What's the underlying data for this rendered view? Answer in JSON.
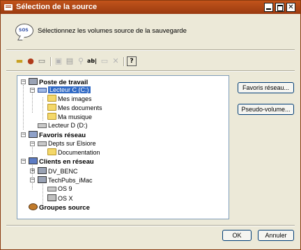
{
  "window": {
    "title": "Sélection de la source",
    "header_text": "Sélectionnez les volumes source de la sauvegarde",
    "header_icon_text": "SOS"
  },
  "toolbar": {
    "icons": [
      "open-folder-icon",
      "user-settings-icon",
      "drive-icon",
      "network-disabled-icon",
      "computer-disabled-icon",
      "filter-disabled-icon",
      "rename-icon",
      "comment-disabled-icon",
      "delete-disabled-icon",
      "help-icon"
    ]
  },
  "tree": {
    "poste_de_travail": "Poste de travail",
    "lecteur_c": "Lecteur C (C:)",
    "mes_images": "Mes images",
    "mes_documents": "Mes documents",
    "ma_musique": "Ma musique",
    "lecteur_d": "Lecteur D (D:)",
    "favoris_reseau": "Favoris réseau",
    "depts": "Depts sur Elsiore",
    "documentation": "Documentation",
    "clients_en_reseau": "Clients en réseau",
    "dv_benc": "DV_BENC",
    "techpubs_imac": "TechPubs_iMac",
    "os9": "OS 9",
    "osx": "OS X",
    "groupes_source": "Groupes source"
  },
  "buttons": {
    "favoris_reseau": "Favoris réseau...",
    "pseudo_volume": "Pseudo-volume...",
    "ok": "OK",
    "annuler": "Annuler"
  }
}
